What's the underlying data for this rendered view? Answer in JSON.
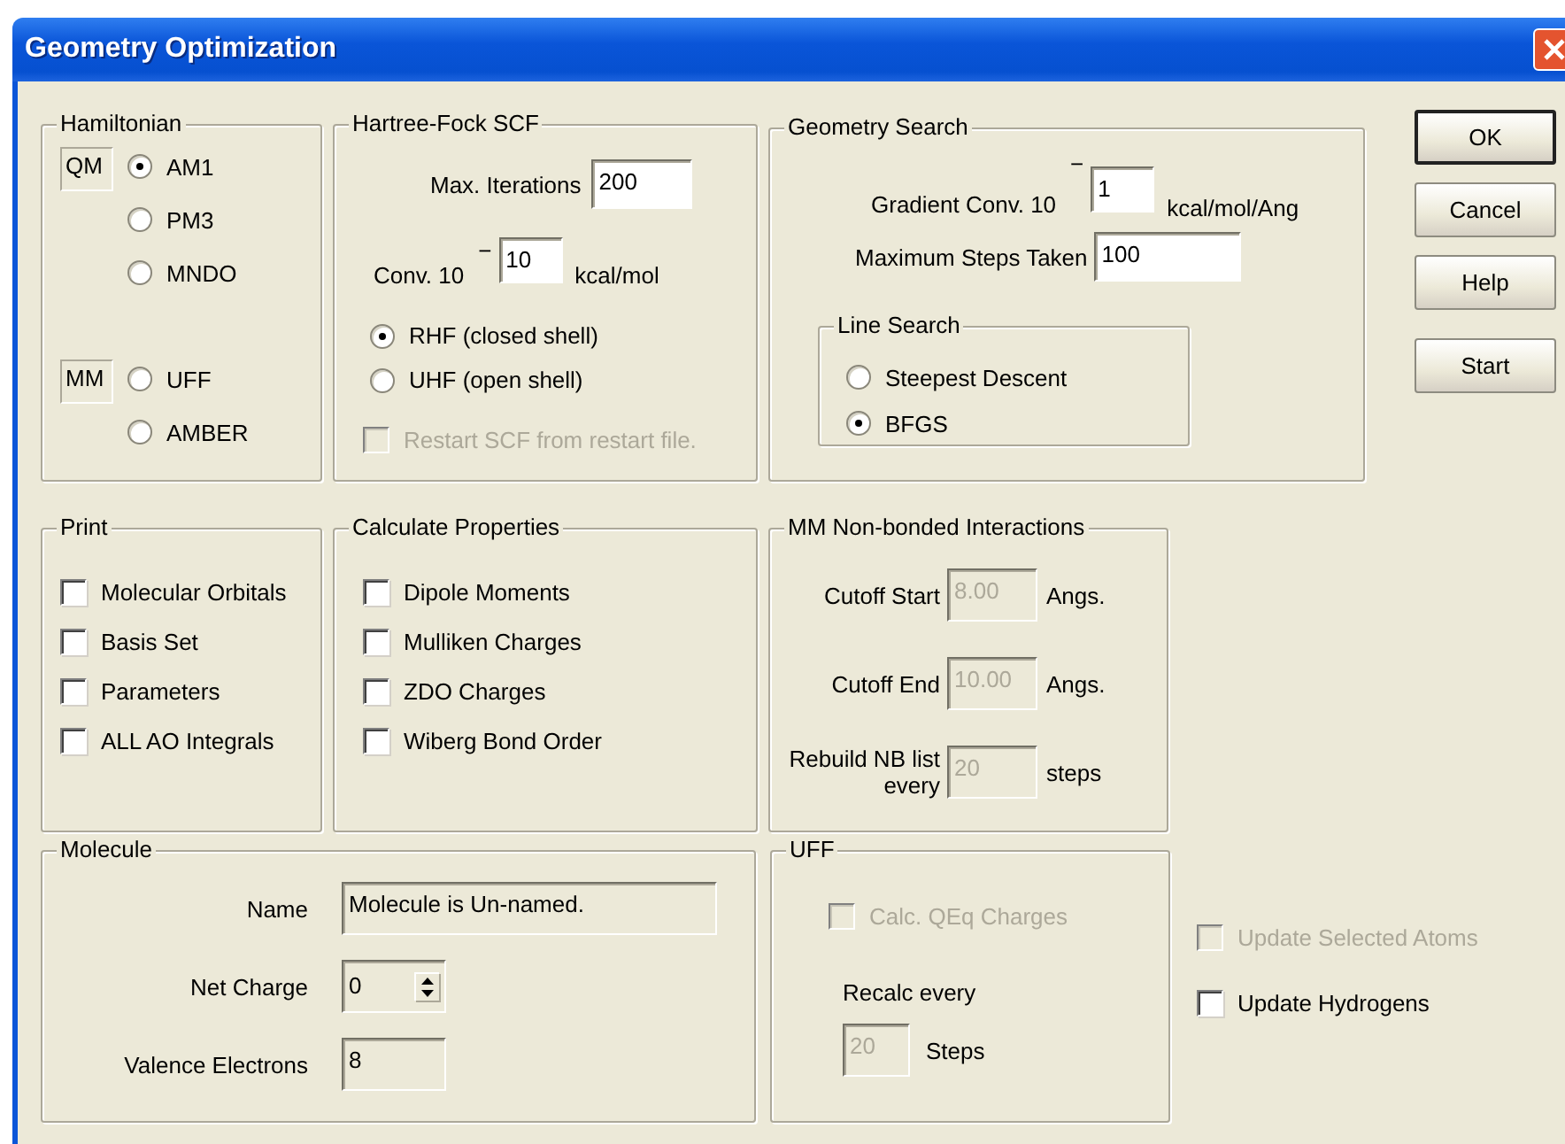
{
  "window": {
    "title": "Geometry Optimization"
  },
  "hamiltonian": {
    "title": "Hamiltonian",
    "groups": [
      {
        "tag": "QM",
        "options": [
          {
            "label": "AM1",
            "selected": true
          },
          {
            "label": "PM3",
            "selected": false
          },
          {
            "label": "MNDO",
            "selected": false
          }
        ]
      },
      {
        "tag": "MM",
        "options": [
          {
            "label": "UFF",
            "selected": false
          },
          {
            "label": "AMBER",
            "selected": false
          }
        ]
      }
    ]
  },
  "hartree_fock": {
    "title": "Hartree-Fock SCF",
    "max_iterations": {
      "label": "Max. Iterations",
      "value": "200"
    },
    "convergence": {
      "label": "Conv.  10",
      "sign": "−",
      "value": "10",
      "unit": "kcal/mol"
    },
    "shell": [
      {
        "label": "RHF (closed shell)",
        "selected": true
      },
      {
        "label": "UHF (open shell)",
        "selected": false
      }
    ],
    "restart": {
      "label": "Restart SCF from restart file.",
      "checked": false,
      "disabled": true
    }
  },
  "geometry_search": {
    "title": "Geometry Search",
    "gradient": {
      "label": "Gradient Conv. 10",
      "sign": "−",
      "value": "1",
      "unit": "kcal/mol/Ang"
    },
    "max_steps": {
      "label": "Maximum Steps Taken",
      "value": "100"
    },
    "line_search": {
      "title": "Line Search",
      "options": [
        {
          "label": "Steepest Descent",
          "selected": false
        },
        {
          "label": "BFGS",
          "selected": true
        }
      ]
    }
  },
  "buttons": [
    {
      "label": "OK",
      "default": true
    },
    {
      "label": "Cancel",
      "default": false
    },
    {
      "label": "Help",
      "default": false
    },
    {
      "label": "Start",
      "default": false
    }
  ],
  "print": {
    "title": "Print",
    "items": [
      {
        "label": "Molecular Orbitals",
        "checked": false
      },
      {
        "label": "Basis Set",
        "checked": false
      },
      {
        "label": "Parameters",
        "checked": false
      },
      {
        "label": "ALL AO Integrals",
        "checked": false
      }
    ]
  },
  "calculate_properties": {
    "title": "Calculate Properties",
    "items": [
      {
        "label": "Dipole Moments",
        "checked": false
      },
      {
        "label": "Mulliken Charges",
        "checked": false
      },
      {
        "label": "ZDO Charges",
        "checked": false
      },
      {
        "label": "Wiberg Bond Order",
        "checked": false
      }
    ]
  },
  "mm_nonbonded": {
    "title": "MM Non-bonded Interactions",
    "fields": [
      {
        "label": "Cutoff Start",
        "value": "8.00",
        "unit": "Angs.",
        "disabled": true
      },
      {
        "label": "Cutoff End",
        "value": "10.00",
        "unit": "Angs.",
        "disabled": true
      },
      {
        "label": "Rebuild NB list every",
        "value": "20",
        "unit": "steps",
        "disabled": true
      }
    ]
  },
  "molecule": {
    "title": "Molecule",
    "fields": [
      {
        "label": "Name",
        "value": "Molecule is Un-named.",
        "kind": "wide"
      },
      {
        "label": "Net Charge",
        "value": "0",
        "kind": "spinner"
      },
      {
        "label": "Valence Electrons",
        "value": "8",
        "kind": "short"
      }
    ]
  },
  "uff": {
    "title": "UFF",
    "qeq": {
      "label": "Calc. QEq Charges",
      "checked": false,
      "disabled": true
    },
    "recalc": {
      "label": "Recalc every",
      "value": "20",
      "unit": "Steps",
      "disabled": true
    }
  },
  "options": [
    {
      "label": "Update Selected Atoms",
      "checked": false,
      "disabled": true
    },
    {
      "label": "Update Hydrogens",
      "checked": false,
      "disabled": false
    }
  ]
}
